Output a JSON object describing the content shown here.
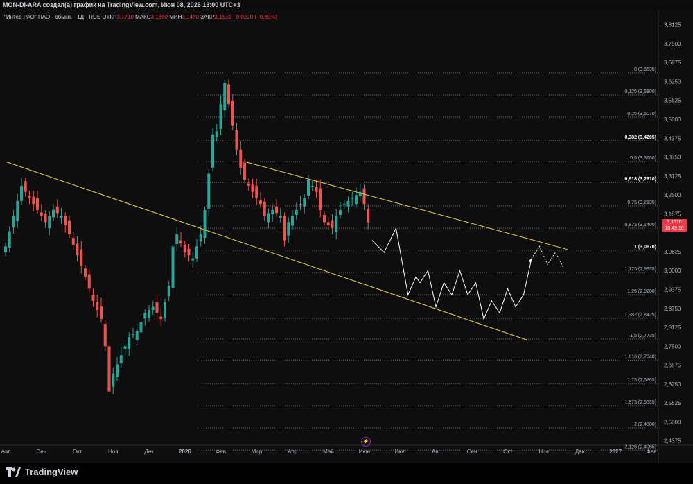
{
  "header": {
    "text": "MON-DI-ARA создал(а) график на TradingView.com, Июн 08, 2026 13:00 UTC+3"
  },
  "legend": {
    "symbol": "\"Интер РАО\" ПАО - обыкн. · 1Д · RUS",
    "open_label": "ОТКР",
    "open": "3,1710",
    "high_label": "МАКС",
    "high": "3,1850",
    "low_label": "МИН",
    "low": "3,1450",
    "close_label": "ЗАКР",
    "close": "3,1510",
    "change": "−0,0220 (−0,69%)"
  },
  "price_tag": {
    "price": "3,1510",
    "countdown": "10:49:16"
  },
  "brand": {
    "name": "TradingView"
  },
  "colors": {
    "up": "#26a69a",
    "down": "#ef5350",
    "trendline": "#e8d44d",
    "projection": "#ffffff",
    "fib": "#6b6b6b",
    "tag": "#f23645"
  },
  "chart_data": {
    "type": "candlestick",
    "x_tick_labels": [
      "Авг",
      "Сен",
      "Окт",
      "Ноя",
      "Дек",
      "2026",
      "Фев",
      "Мар",
      "Апр",
      "Май",
      "Июн",
      "Июл",
      "Авг",
      "Сен",
      "Окт",
      "Ноя",
      "Дек",
      "2027",
      "Фев"
    ],
    "y_tick_labels": [
      "3,8125",
      "3,7500",
      "3,6875",
      "3,6250",
      "3,5625",
      "3,5000",
      "3,4375",
      "3,3750",
      "3,3125",
      "3,2500",
      "3,1875",
      "3,0625",
      "3,0000",
      "2,9375",
      "2,8750",
      "2,8125",
      "2,7500",
      "2,6875",
      "2,6250",
      "2,5625",
      "2,5000",
      "2,4375"
    ],
    "ylim": [
      2.43,
      3.83
    ],
    "fib_levels": [
      {
        "label": "0 (3,6535)",
        "value": 3.6535,
        "bold": false
      },
      {
        "label": "0,125 (3,5800)",
        "value": 3.58,
        "bold": false
      },
      {
        "label": "0,25 (3,5070)",
        "value": 3.507,
        "bold": false
      },
      {
        "label": "0,382 (3,4295)",
        "value": 3.4295,
        "bold": true
      },
      {
        "label": "0,5 (3,3600)",
        "value": 3.36,
        "bold": false
      },
      {
        "label": "0,618 (3,2910)",
        "value": 3.291,
        "bold": true
      },
      {
        "label": "0,75 (3,2135)",
        "value": 3.2135,
        "bold": false
      },
      {
        "label": "0,875 (3,1400)",
        "value": 3.14,
        "bold": false
      },
      {
        "label": "1 (3,0670)",
        "value": 3.067,
        "bold": true
      },
      {
        "label": "1,125 (2,9935)",
        "value": 2.9935,
        "bold": false
      },
      {
        "label": "1,25 (2,9200)",
        "value": 2.92,
        "bold": false
      },
      {
        "label": "1,382 (2,8425)",
        "value": 2.8425,
        "bold": false
      },
      {
        "label": "1,5 (2,7735)",
        "value": 2.7735,
        "bold": false
      },
      {
        "label": "1,618 (2,7040)",
        "value": 2.704,
        "bold": false
      },
      {
        "label": "1,75 (2,6265)",
        "value": 2.6265,
        "bold": false
      },
      {
        "label": "1,875 (2,5535)",
        "value": 2.5535,
        "bold": false
      },
      {
        "label": "2 (2,4800)",
        "value": 2.48,
        "bold": false
      },
      {
        "label": "2,125 (2,4065)",
        "value": 2.4065,
        "bold": false
      }
    ],
    "close_path": [
      [
        0,
        3.08
      ],
      [
        2,
        3.18
      ],
      [
        4,
        3.28
      ],
      [
        6,
        3.24
      ],
      [
        8,
        3.2
      ],
      [
        10,
        3.16
      ],
      [
        12,
        3.2
      ],
      [
        14,
        3.18
      ],
      [
        16,
        3.12
      ],
      [
        18,
        3.05
      ],
      [
        20,
        2.98
      ],
      [
        22,
        2.9
      ],
      [
        24,
        2.84
      ],
      [
        25,
        2.75
      ],
      [
        26,
        2.6
      ],
      [
        27,
        2.66
      ],
      [
        29,
        2.72
      ],
      [
        31,
        2.78
      ],
      [
        33,
        2.8
      ],
      [
        35,
        2.86
      ],
      [
        37,
        2.88
      ],
      [
        39,
        2.84
      ],
      [
        41,
        2.95
      ],
      [
        42,
        3.08
      ],
      [
        43,
        3.12
      ],
      [
        45,
        3.06
      ],
      [
        47,
        3.04
      ],
      [
        49,
        3.12
      ],
      [
        50,
        3.2
      ],
      [
        51,
        3.32
      ],
      [
        52,
        3.45
      ],
      [
        53,
        3.46
      ],
      [
        54,
        3.55
      ],
      [
        55,
        3.62
      ],
      [
        56,
        3.55
      ],
      [
        57,
        3.48
      ],
      [
        58,
        3.4
      ],
      [
        59,
        3.34
      ],
      [
        60,
        3.3
      ],
      [
        62,
        3.26
      ],
      [
        64,
        3.22
      ],
      [
        65,
        3.18
      ],
      [
        67,
        3.2
      ],
      [
        69,
        3.18
      ],
      [
        70,
        3.1
      ],
      [
        71,
        3.16
      ],
      [
        73,
        3.2
      ],
      [
        75,
        3.24
      ],
      [
        76,
        3.3
      ],
      [
        78,
        3.26
      ],
      [
        79,
        3.2
      ],
      [
        80,
        3.16
      ],
      [
        82,
        3.14
      ],
      [
        83,
        3.18
      ],
      [
        85,
        3.22
      ],
      [
        87,
        3.24
      ],
      [
        89,
        3.26
      ],
      [
        90,
        3.22
      ],
      [
        91,
        3.16
      ]
    ],
    "projection_path": [
      [
        92,
        3.1
      ],
      [
        95,
        3.06
      ],
      [
        98,
        3.14
      ],
      [
        101,
        2.92
      ],
      [
        103,
        2.98
      ],
      [
        104,
        2.96
      ],
      [
        106,
        3.0
      ],
      [
        108,
        2.88
      ],
      [
        110,
        2.96
      ],
      [
        112,
        2.92
      ],
      [
        114,
        3.0
      ],
      [
        116,
        2.92
      ],
      [
        118,
        2.96
      ],
      [
        120,
        2.84
      ],
      [
        122,
        2.9
      ],
      [
        124,
        2.86
      ],
      [
        126,
        2.94
      ],
      [
        128,
        2.88
      ],
      [
        130,
        2.92
      ],
      [
        132,
        3.04
      ]
    ],
    "projection_dotted": [
      [
        132,
        3.04
      ],
      [
        134,
        3.08
      ],
      [
        136,
        3.02
      ],
      [
        138,
        3.06
      ],
      [
        140,
        3.01
      ]
    ],
    "trendlines": [
      {
        "from": [
          0,
          3.36
        ],
        "to": [
          131,
          2.77
        ]
      },
      {
        "from": [
          60,
          3.36
        ],
        "to": [
          141,
          3.07
        ]
      }
    ]
  }
}
